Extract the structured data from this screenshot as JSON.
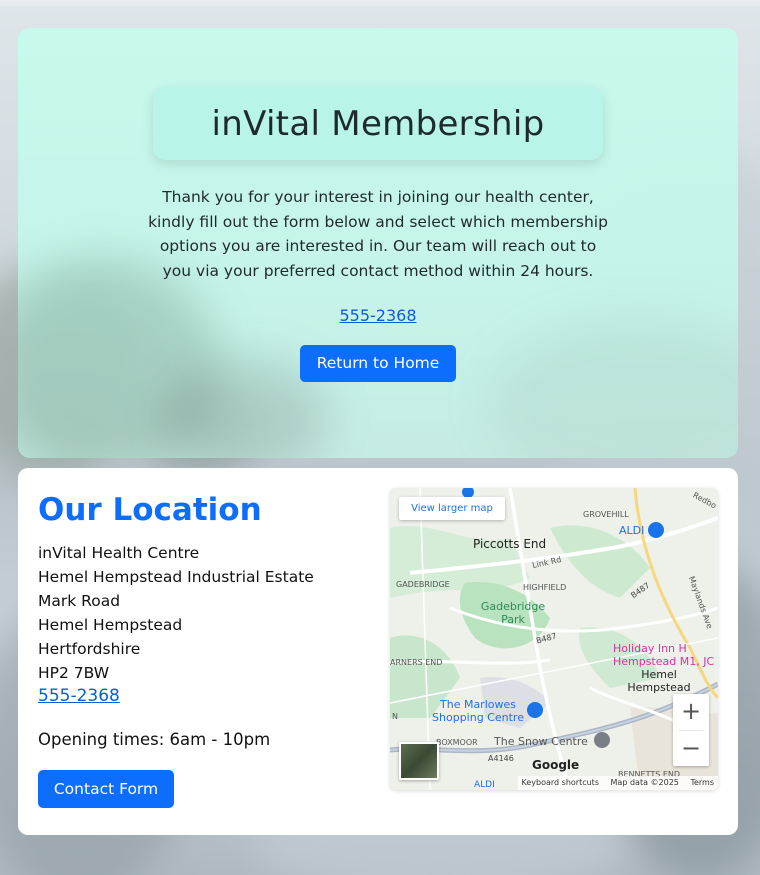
{
  "hero": {
    "title": "inVital Membership",
    "intro": "Thank you for your interest in joining our health center, kindly fill out the form below and select which membership options you are interested in. Our team will reach out to you via your preferred contact method within 24 hours.",
    "phone": "555-2368",
    "return_label": "Return to Home"
  },
  "location": {
    "heading": "Our Location",
    "address": [
      "inVital Health Centre",
      "Hemel Hempstead Industrial Estate",
      "Mark Road",
      "Hemel Hempstead",
      "Hertfordshire",
      "HP2 7BW"
    ],
    "phone": "555-2368",
    "hours": "Opening times: 6am - 10pm",
    "contact_label": "Contact Form"
  },
  "map": {
    "view_larger": "View larger map",
    "zoom_in": "+",
    "zoom_out": "−",
    "logo": "Google",
    "shortcuts": "Keyboard shortcuts",
    "map_data": "Map data ©2025",
    "terms": "Terms",
    "labels": {
      "grovehill": "GROVEHILL",
      "redbourn": "Redbo",
      "aldi": "ALDI",
      "aldi2": "ALDI",
      "piccotts_end": "Piccotts End",
      "link_rd": "Link Rd",
      "gadebridge_area": "GADEBRIDGE",
      "highfield": "HIGHFIELD",
      "b487_1": "B487",
      "maylands": "Maylands Ave",
      "gadebridge_park": "Gadebridge Park",
      "b487_2": "B487",
      "holiday_inn": "Holiday Inn H Hempstead M1, JC",
      "warners_end": "ARNERS END",
      "hemel": "Hemel Hempstead",
      "marlowes": "The Marlowes Shopping Centre",
      "boxmoor": "BOXMOOR",
      "snow_centre": "The Snow Centre",
      "a4146": "A4146",
      "bennetts_end": "BENNETTS END",
      "n_label": "N"
    }
  },
  "colors": {
    "accent": "#0d6efd",
    "hero_bg": "#c6faec",
    "title_box": "#b8f5e8",
    "link": "#0b5ed7"
  }
}
